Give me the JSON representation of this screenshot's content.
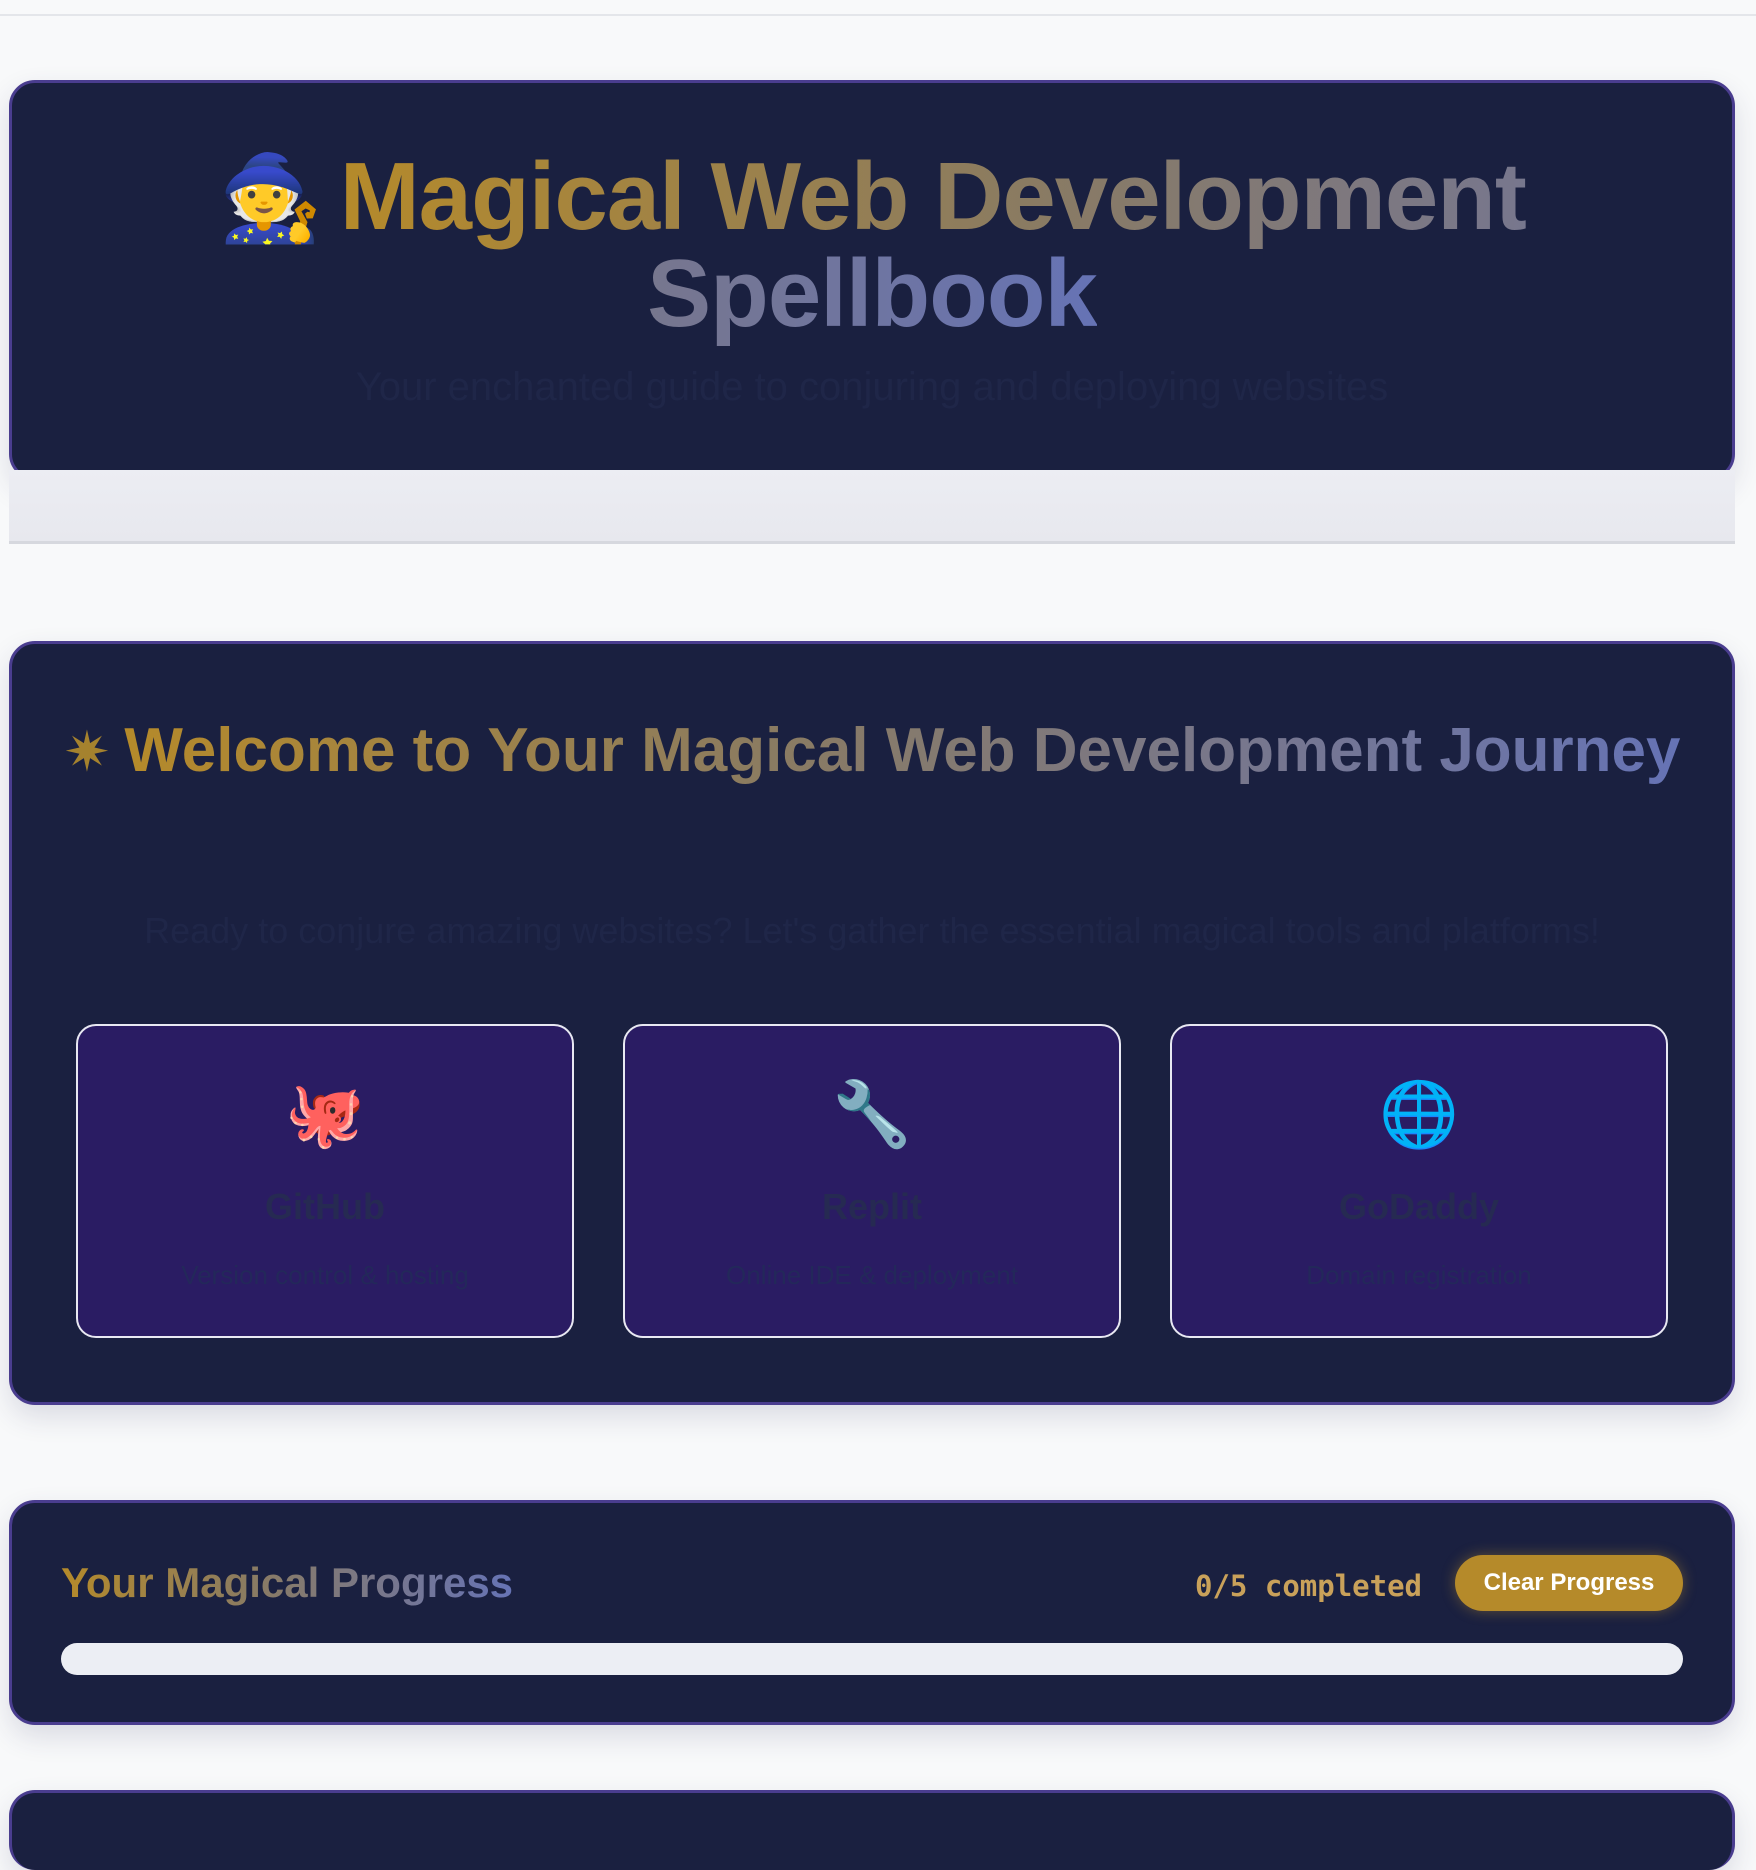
{
  "hero": {
    "icon": "wizard-icon",
    "title": "Magical Web Development Spellbook",
    "subtitle": "Your enchanted guide to conjuring and deploying websites"
  },
  "welcome": {
    "icon": "sparkle-icon",
    "title": "Welcome to Your Magical Web Development Journey",
    "subtitle": "Ready to conjure amazing websites? Let's gather the essential magical tools and platforms!",
    "tools": [
      {
        "emoji": "🐙",
        "icon": "octopus-icon",
        "name": "GitHub",
        "desc": "Version control & hosting"
      },
      {
        "emoji": "🔧",
        "icon": "wrench-icon",
        "name": "Replit",
        "desc": "Online IDE & deployment"
      },
      {
        "emoji": "🌐",
        "icon": "globe-icon",
        "name": "GoDaddy",
        "desc": "Domain registration"
      }
    ]
  },
  "progress": {
    "title": "Your Magical Progress",
    "count_text": "0/5 completed",
    "completed": 0,
    "total": 5,
    "clear_label": "Clear Progress"
  },
  "colors": {
    "panel": "#1a2040",
    "panel_border": "#4a3d8f",
    "card": "#2a1c63",
    "gold": "#b58a2a",
    "blue": "#6673b5"
  }
}
